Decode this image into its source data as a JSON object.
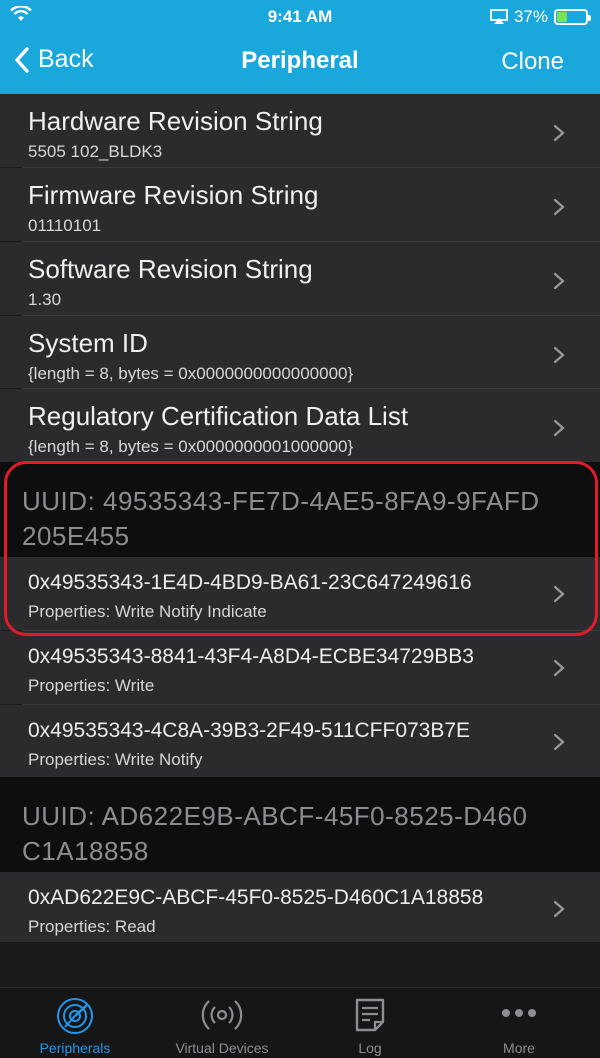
{
  "status": {
    "time": "9:41 AM",
    "battery": "37%",
    "battery_level": 0.37
  },
  "nav": {
    "back_label": "Back",
    "title": "Peripheral",
    "action_label": "Clone"
  },
  "info_rows": [
    {
      "title": "Hardware Revision String",
      "value": "5505 102_BLDK3"
    },
    {
      "title": "Firmware Revision String",
      "value": "01110101"
    },
    {
      "title": "Software Revision String",
      "value": "1.30"
    },
    {
      "title": "System ID",
      "value": "{length = 8, bytes = 0x0000000000000000}"
    },
    {
      "title": "Regulatory Certification Data List",
      "value": "{length = 8, bytes = 0x0000000001000000}"
    }
  ],
  "services": [
    {
      "header": "UUID: 49535343-FE7D-4AE5-8FA9-9FAFD205E455",
      "characteristics": [
        {
          "uuid": "0x49535343-1E4D-4BD9-BA61-23C647249616",
          "properties": "Properties: Write Notify Indicate"
        },
        {
          "uuid": "0x49535343-8841-43F4-A8D4-ECBE34729BB3",
          "properties": "Properties: Write"
        },
        {
          "uuid": "0x49535343-4C8A-39B3-2F49-511CFF073B7E",
          "properties": "Properties: Write Notify"
        }
      ]
    },
    {
      "header": "UUID: AD622E9B-ABCF-45F0-8525-D460C1A18858",
      "characteristics": [
        {
          "uuid": "0xAD622E9C-ABCF-45F0-8525-D460C1A18858",
          "properties": "Properties: Read"
        }
      ]
    }
  ],
  "tabs": [
    {
      "label": "Peripherals",
      "icon": "radar-icon",
      "active": true
    },
    {
      "label": "Virtual Devices",
      "icon": "broadcast-icon",
      "active": false
    },
    {
      "label": "Log",
      "icon": "log-icon",
      "active": false
    },
    {
      "label": "More",
      "icon": "more-icon",
      "active": false
    }
  ],
  "colors": {
    "header_blue": "#1aa8dc",
    "highlight_red": "#e21b2a",
    "tab_active": "#2396ea"
  }
}
